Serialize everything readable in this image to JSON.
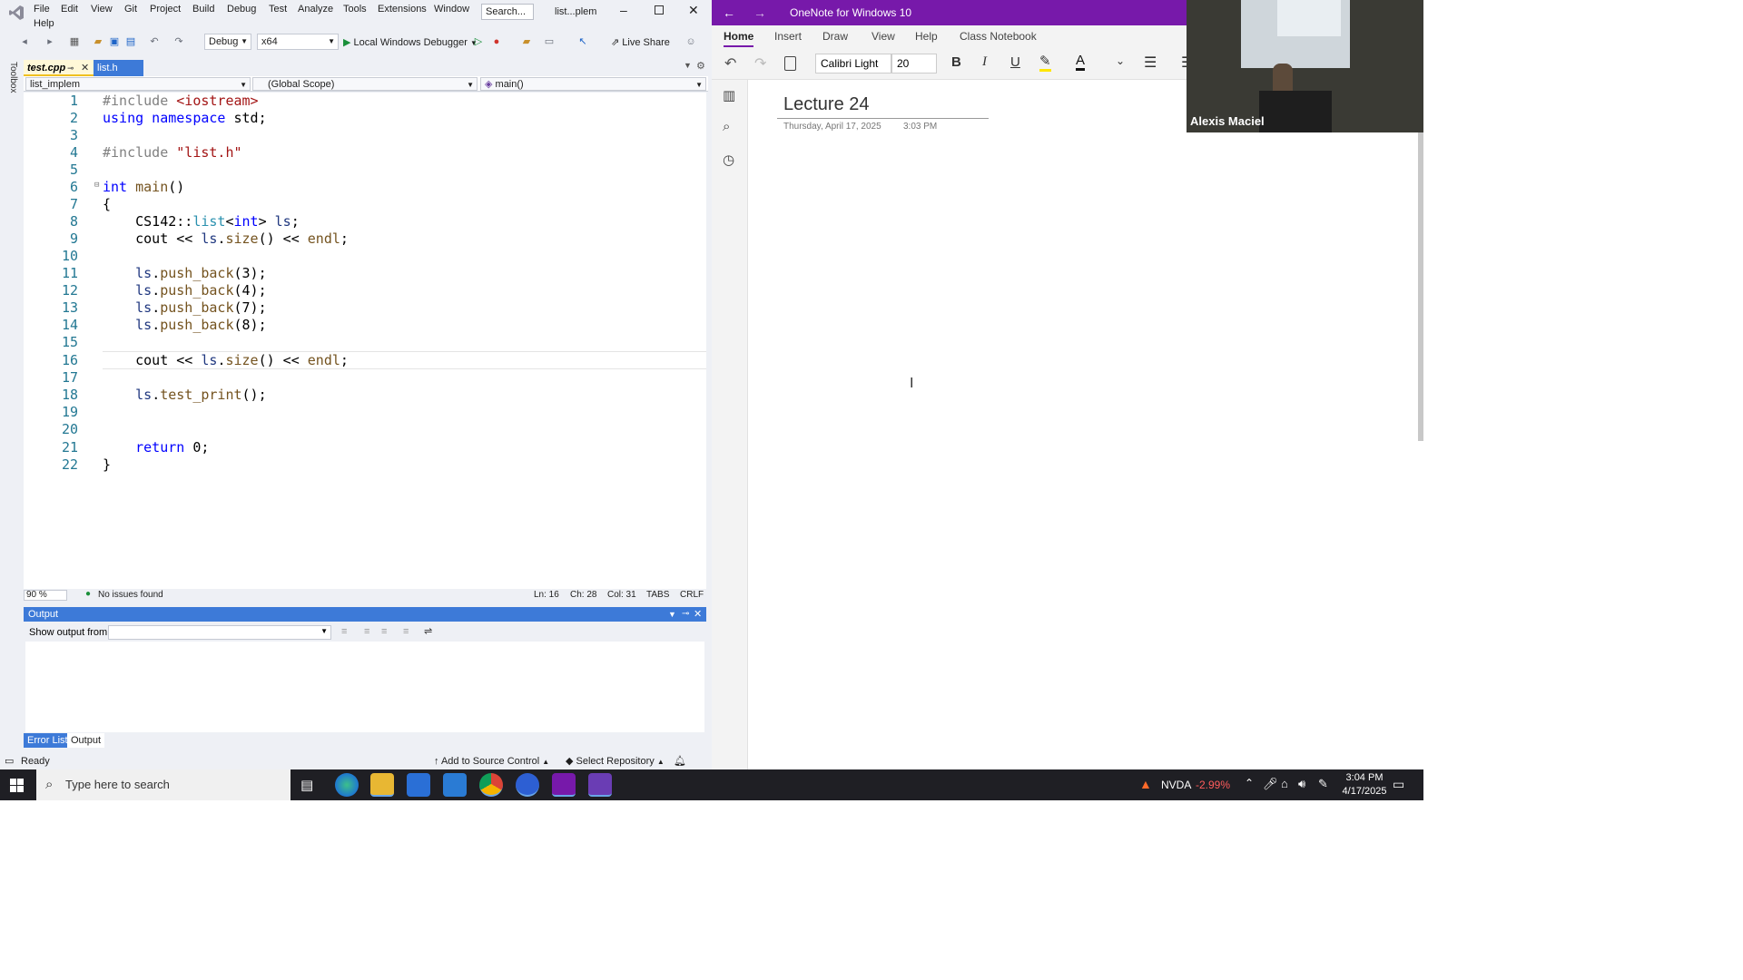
{
  "vs": {
    "menu": [
      "File",
      "Edit",
      "View",
      "Git",
      "Project",
      "Build",
      "Debug",
      "Test",
      "Analyze",
      "Tools",
      "Extensions",
      "Window",
      "Help"
    ],
    "search_placeholder": "Search...",
    "window_title": "list...plem",
    "toolbar": {
      "config": "Debug",
      "platform": "x64",
      "debugger": "Local Windows Debugger",
      "live_share": "Live Share"
    },
    "tabs": [
      {
        "label": "test.cpp",
        "active": true
      },
      {
        "label": "list.h",
        "active": false
      }
    ],
    "toolbox_label": "Toolbox",
    "nav": {
      "project": "list_implem",
      "scope": "(Global Scope)",
      "member": "main()"
    },
    "code_lines": [
      {
        "n": "1",
        "text": "#include <iostream>"
      },
      {
        "n": "2",
        "text": "using namespace std;"
      },
      {
        "n": "3",
        "text": ""
      },
      {
        "n": "4",
        "text": "#include \"list.h\""
      },
      {
        "n": "5",
        "text": ""
      },
      {
        "n": "6",
        "text": "int main()"
      },
      {
        "n": "7",
        "text": "{"
      },
      {
        "n": "8",
        "text": "    CS142::list<int> ls;"
      },
      {
        "n": "9",
        "text": "    cout << ls.size() << endl;"
      },
      {
        "n": "10",
        "text": ""
      },
      {
        "n": "11",
        "text": "    ls.push_back(3);"
      },
      {
        "n": "12",
        "text": "    ls.push_back(4);"
      },
      {
        "n": "13",
        "text": "    ls.push_back(7);"
      },
      {
        "n": "14",
        "text": "    ls.push_back(8);"
      },
      {
        "n": "15",
        "text": ""
      },
      {
        "n": "16",
        "text": "    cout << ls.size() << endl;"
      },
      {
        "n": "17",
        "text": ""
      },
      {
        "n": "18",
        "text": "    ls.test_print();"
      },
      {
        "n": "19",
        "text": ""
      },
      {
        "n": "20",
        "text": ""
      },
      {
        "n": "21",
        "text": "    return 0;"
      },
      {
        "n": "22",
        "text": "}"
      }
    ],
    "editor_status": {
      "zoom": "90 %",
      "issues": "No issues found",
      "ln": "Ln: 16",
      "ch": "Ch: 28",
      "col": "Col: 31",
      "tabs": "TABS",
      "eol": "CRLF"
    },
    "output": {
      "title": "Output",
      "show_from": "Show output from:"
    },
    "bottom_tabs": [
      "Error List",
      "Output"
    ],
    "status": {
      "ready": "Ready",
      "source_control": "Add to Source Control",
      "repo": "Select Repository"
    }
  },
  "onenote": {
    "app_title": "OneNote for Windows 10",
    "tabs": [
      "Home",
      "Insert",
      "Draw",
      "View",
      "Help",
      "Class Notebook"
    ],
    "font_name": "Calibri Light",
    "font_size": "20",
    "page_title": "Lecture 24",
    "date": "Thursday, April 17, 2025",
    "time": "3:03 PM"
  },
  "webcam": {
    "name": "Alexis Maciel"
  },
  "taskbar": {
    "search_placeholder": "Type here to search",
    "stock_name": "NVDA",
    "stock_change": "-2.99%",
    "clock_time": "3:04 PM",
    "clock_date": "4/17/2025"
  },
  "colors": {
    "vs_accent": "#3d7ad8",
    "onenote_purple": "#7719aa",
    "taskbar": "#1f1f24"
  }
}
